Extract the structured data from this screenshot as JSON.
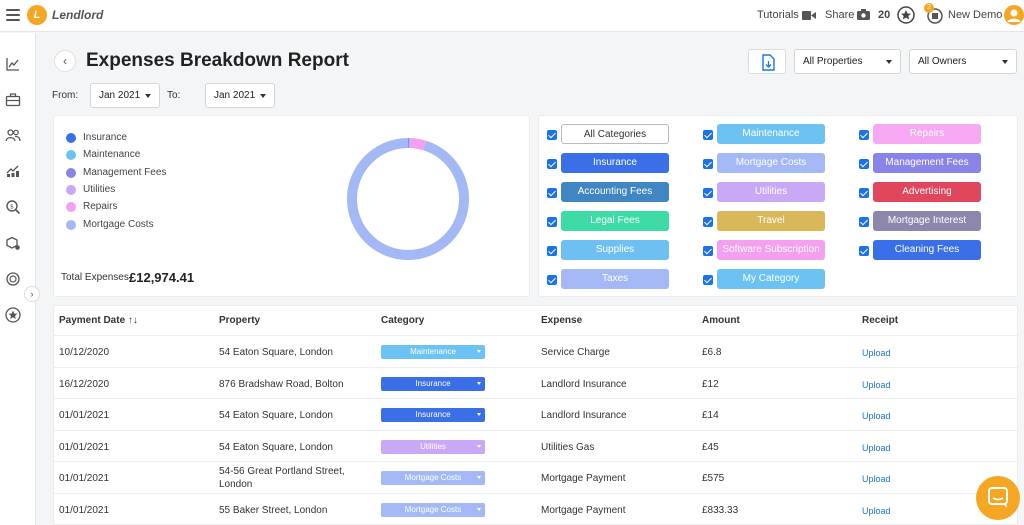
{
  "app": {
    "logo_letter": "L",
    "name": "Lendlord"
  },
  "topbar": {
    "tutorials": "Tutorials",
    "share": "Share",
    "points": "20",
    "notifications": "2",
    "user": "New Demo"
  },
  "header": {
    "title": "Expenses Breakdown Report",
    "properties_filter": "All Properties",
    "owners_filter": "All Owners",
    "from_label": "From:",
    "from_value": "Jan 2021",
    "to_label": "To:",
    "to_value": "Jan 2021"
  },
  "legend": [
    {
      "label": "Insurance",
      "color": "#3b6fe8"
    },
    {
      "label": "Maintenance",
      "color": "#6cc2f2"
    },
    {
      "label": "Management Fees",
      "color": "#8a84e8"
    },
    {
      "label": "Utilities",
      "color": "#c9a8f5"
    },
    {
      "label": "Repairs",
      "color": "#f59ff0"
    },
    {
      "label": "Mortgage Costs",
      "color": "#a3b8f5"
    }
  ],
  "donut": {
    "segments": [
      {
        "name": "Insurance",
        "value": 0.2,
        "color": "#3b6fe8"
      },
      {
        "name": "Maintenance",
        "value": 0.05,
        "color": "#6cc2f2"
      },
      {
        "name": "Utilities",
        "value": 0.35,
        "color": "#c9a8f5"
      },
      {
        "name": "Repairs",
        "value": 4.2,
        "color": "#f59ff0"
      },
      {
        "name": "Mortgage Costs",
        "value": 95.2,
        "color": "#a3b8f5"
      }
    ]
  },
  "totals": {
    "label": "Total Expenses",
    "value": "£12,974.41"
  },
  "categories": [
    {
      "label": "All Categories",
      "color": "#ffffff",
      "text": "#333333",
      "border": true
    },
    {
      "label": "Maintenance",
      "color": "#6cc2f2"
    },
    {
      "label": "Repairs",
      "color": "#f7a8f2"
    },
    {
      "label": "Insurance",
      "color": "#3b6fe8"
    },
    {
      "label": "Mortgage Costs",
      "color": "#a3b8f5"
    },
    {
      "label": "Management Fees",
      "color": "#8a84e8"
    },
    {
      "label": "Accounting Fees",
      "color": "#3f86c2"
    },
    {
      "label": "Utilities",
      "color": "#c9a8f5"
    },
    {
      "label": "Advertising",
      "color": "#e0475c"
    },
    {
      "label": "Legal Fees",
      "color": "#3ddba6"
    },
    {
      "label": "Travel",
      "color": "#d9b85a"
    },
    {
      "label": "Mortgage Interest",
      "color": "#8d86ad"
    },
    {
      "label": "Supplies",
      "color": "#6ec0f2"
    },
    {
      "label": "Software Subscription",
      "color": "#f59ff0"
    },
    {
      "label": "Cleaning Fees",
      "color": "#3b6fe8"
    },
    {
      "label": "Taxes",
      "color": "#a3b8f5"
    },
    {
      "label": "My Category",
      "color": "#6cc2f2"
    }
  ],
  "table": {
    "headers": [
      "Payment Date ↑↓",
      "Property",
      "Category",
      "Expense",
      "Amount",
      "Receipt"
    ],
    "rows": [
      {
        "date": "10/12/2020",
        "property": "54 Eaton Square, London",
        "category": "Maintenance",
        "color": "#6cc2f2",
        "expense": "Service Charge",
        "amount": "£6.8",
        "receipt": "Upload"
      },
      {
        "date": "16/12/2020",
        "property": "876 Bradshaw Road, Bolton",
        "category": "Insurance",
        "color": "#3b6fe8",
        "expense": "Landlord Insurance",
        "amount": "£12",
        "receipt": "Upload"
      },
      {
        "date": "01/01/2021",
        "property": "54 Eaton Square, London",
        "category": "Insurance",
        "color": "#3b6fe8",
        "expense": "Landlord Insurance",
        "amount": "£14",
        "receipt": "Upload"
      },
      {
        "date": "01/01/2021",
        "property": "54 Eaton Square, London",
        "category": "Utilities",
        "color": "#c9a8f5",
        "expense": "Utilities Gas",
        "amount": "£45",
        "receipt": "Upload"
      },
      {
        "date": "01/01/2021",
        "property": "54-56 Great Portland Street, London",
        "category": "Mortgage Costs",
        "color": "#a3b8f5",
        "expense": "Mortgage Payment",
        "amount": "£575",
        "receipt": "Upload"
      },
      {
        "date": "01/01/2021",
        "property": "55 Baker Street, London",
        "category": "Mortgage Costs",
        "color": "#a3b8f5",
        "expense": "Mortgage Payment",
        "amount": "£833.33",
        "receipt": "Upload"
      }
    ]
  }
}
